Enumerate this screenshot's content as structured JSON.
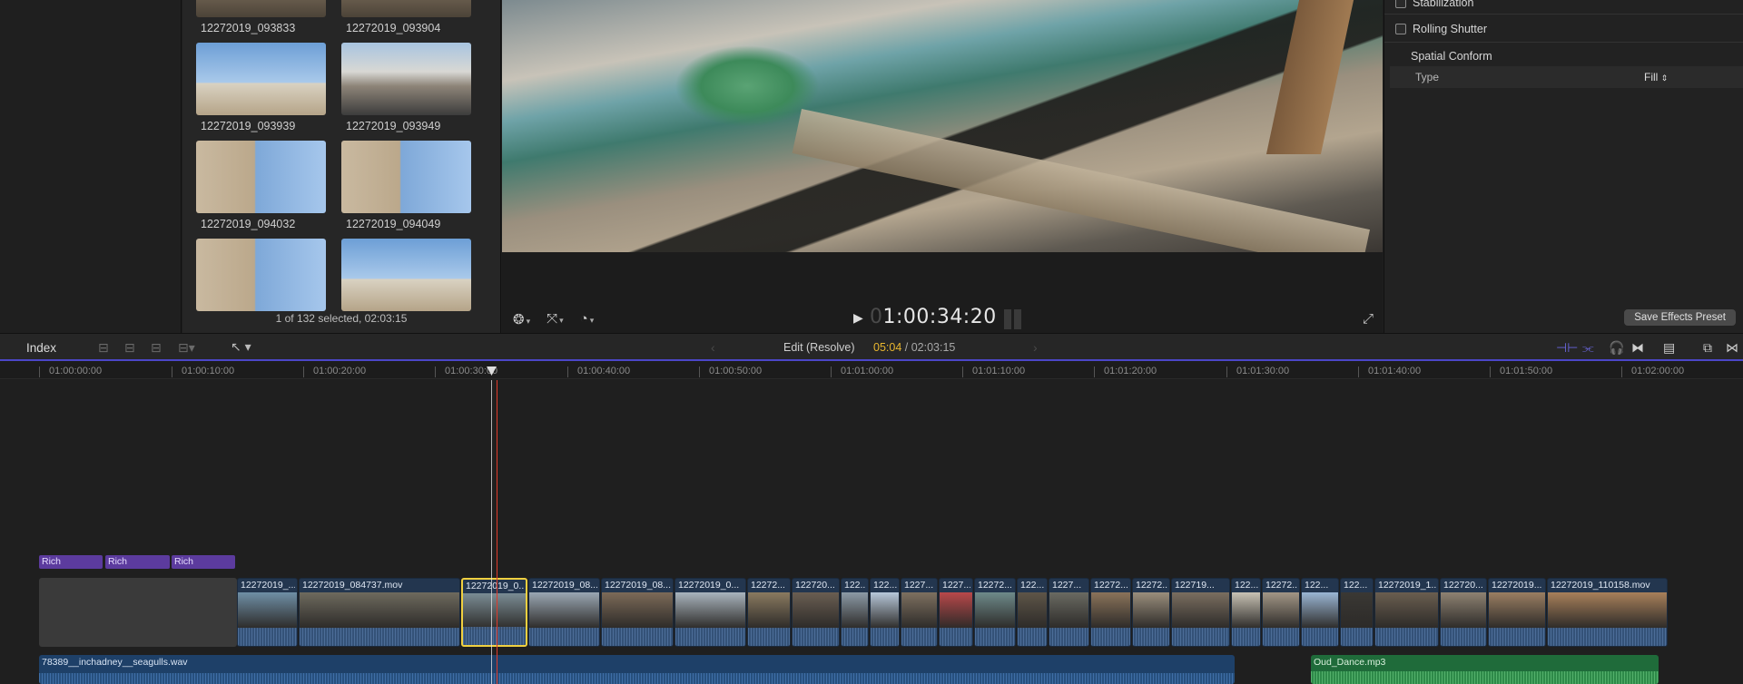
{
  "browser": {
    "thumbnails": [
      {
        "label": "12272019_093833",
        "style": "boats"
      },
      {
        "label": "12272019_093904",
        "style": "boats"
      },
      {
        "label": "12272019_093939",
        "style": "sky"
      },
      {
        "label": "12272019_093949",
        "style": "street"
      },
      {
        "label": "12272019_094032",
        "style": "bal"
      },
      {
        "label": "12272019_094049",
        "style": "bal"
      },
      {
        "label": "",
        "style": "bal"
      },
      {
        "label": "",
        "style": "sky"
      }
    ],
    "status": "1 of 132 selected, 02:03:15"
  },
  "viewer": {
    "timecode_dim": "0",
    "timecode": "1:00:34:20"
  },
  "inspector": {
    "stabilization": "Stabilization",
    "rolling_shutter": "Rolling Shutter",
    "spatial_conform": "Spatial Conform",
    "type_label": "Type",
    "type_value": "Fill",
    "save_preset": "Save Effects Preset"
  },
  "timeline_toolbar": {
    "index": "Index",
    "edit_title": "Edit (Resolve)",
    "duration_current": "05:04",
    "duration_total": "02:03:15"
  },
  "ruler": [
    "01:00:00:00",
    "01:00:10:00",
    "01:00:20:00",
    "01:00:30:00",
    "01:00:40:00",
    "01:00:50:00",
    "01:01:00:00",
    "01:01:10:00",
    "01:01:20:00",
    "01:01:30:00",
    "01:01:40:00",
    "01:01:50:00",
    "01:02:00:00"
  ],
  "title_clips": [
    "Rich",
    "Rich",
    "Rich"
  ],
  "clips": [
    {
      "name": "12272019_...",
      "color": "#6f8fa6"
    },
    {
      "name": "12272019_084737.mov",
      "color": "#6e6a5e"
    },
    {
      "name": "12272019_0...",
      "color": "#7a8c94",
      "selected": true
    },
    {
      "name": "12272019_08...",
      "color": "#9aa7b3"
    },
    {
      "name": "12272019_08...",
      "color": "#7c6a58"
    },
    {
      "name": "12272019_0...",
      "color": "#a9b4bd"
    },
    {
      "name": "12272...",
      "color": "#8a7a60"
    },
    {
      "name": "122720...",
      "color": "#6a5e52"
    },
    {
      "name": "122...",
      "color": "#8c9aa6"
    },
    {
      "name": "122...",
      "color": "#b7c8da"
    },
    {
      "name": "1227...",
      "color": "#7d7060"
    },
    {
      "name": "1227...",
      "color": "#b8484a"
    },
    {
      "name": "12272...",
      "color": "#6e8a8a"
    },
    {
      "name": "122...",
      "color": "#5e5548"
    },
    {
      "name": "1227...",
      "color": "#6a6a62"
    },
    {
      "name": "12272...",
      "color": "#8a735a"
    },
    {
      "name": "12272...",
      "color": "#9a8e7c"
    },
    {
      "name": "122719...",
      "color": "#7a6e60"
    },
    {
      "name": "122...",
      "color": "#c8c2b4"
    },
    {
      "name": "12272...",
      "color": "#a29686"
    },
    {
      "name": "122...",
      "color": "#9ab6d4"
    },
    {
      "name": "122...",
      "color": "#3a3834"
    },
    {
      "name": "12272019_1...",
      "color": "#6a5e50"
    },
    {
      "name": "122720...",
      "color": "#8e8272"
    },
    {
      "name": "12272019...",
      "color": "#9a7e62"
    },
    {
      "name": "12272019_110158.mov",
      "color": "#a8805a"
    }
  ],
  "audio": {
    "seagulls": "78389__inchadney__seagulls.wav",
    "oud": "Oud_Dance.mp3"
  }
}
